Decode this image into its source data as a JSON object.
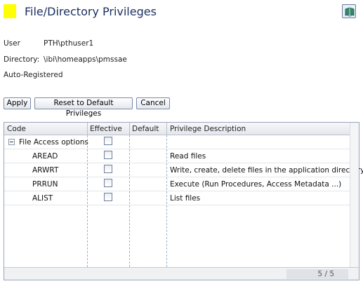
{
  "header": {
    "title": "File/Directory Privileges",
    "accent_color": "#ffff00",
    "help_icon": "book-help-icon"
  },
  "info": {
    "user_label": "User",
    "user_value": "PTH\\pthuser1",
    "directory_label": "Directory:",
    "directory_value": "\\ibi\\homeapps\\pmssae",
    "status": "Auto-Registered"
  },
  "toolbar": {
    "apply_label": "Apply",
    "reset_label": "Reset to Default Privileges",
    "cancel_label": "Cancel"
  },
  "grid": {
    "columns": [
      "Code",
      "Effective",
      "Default",
      "Privilege Description"
    ],
    "group_label": "File Access options",
    "rows": [
      {
        "code": "AREAD",
        "description": "Read files",
        "effective": false
      },
      {
        "code": "ARWRT",
        "description": "Write, create, delete files in the application directory",
        "effective": false
      },
      {
        "code": "PRRUN",
        "description": "Execute (Run Procedures, Access Metadata ...)",
        "effective": false
      },
      {
        "code": "ALIST",
        "description": "List files",
        "effective": false
      }
    ],
    "pager": "5 / 5"
  }
}
